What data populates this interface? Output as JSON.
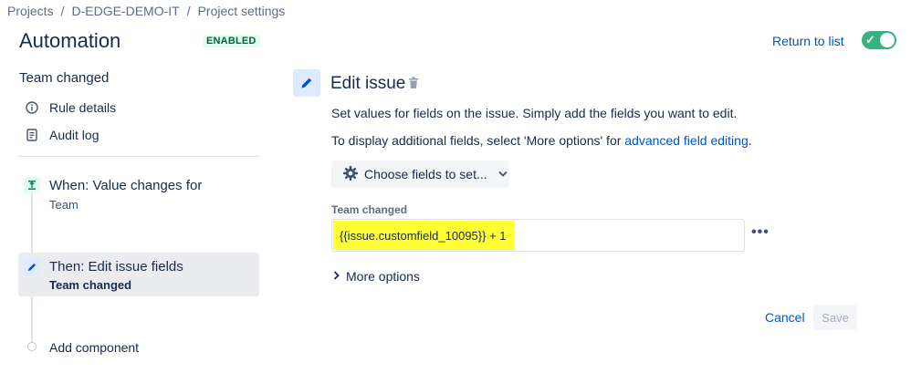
{
  "breadcrumb": [
    "Projects",
    "D-EDGE-DEMO-IT",
    "Project settings"
  ],
  "breadcrumb_separator": "/",
  "header": {
    "title": "Automation",
    "status_badge": "ENABLED",
    "return_link": "Return to list",
    "toggle_state": "on"
  },
  "sidebar": {
    "rule_name": "Team changed",
    "items": [
      {
        "label": "Rule details",
        "icon": "info-icon"
      },
      {
        "label": "Audit log",
        "icon": "document-icon"
      }
    ],
    "steps": [
      {
        "title": "When: Value changes for",
        "subtitle": "Team",
        "icon": "trigger-icon"
      },
      {
        "title": "Then: Edit issue fields",
        "subtitle": "Team changed",
        "icon": "pencil-icon",
        "selected": true
      }
    ],
    "add_component": "Add component"
  },
  "main": {
    "title": "Edit issue",
    "description": "Set values for fields on the issue. Simply add the fields you want to edit.",
    "additional_text": "To display additional fields, select 'More options' for ",
    "additional_link": "advanced field editing",
    "additional_suffix": ".",
    "choose_fields_label": "Choose fields to set...",
    "field": {
      "label": "Team changed",
      "value": "{{issue.customfield_10095}} + 1"
    },
    "more_options_label": "More options",
    "cancel_label": "Cancel",
    "save_label": "Save"
  },
  "colors": {
    "accent": "#0052cc",
    "toggle": "#36b37e",
    "highlight": "#ffff33",
    "badge_text": "#006644",
    "badge_bg": "#e3fcef"
  }
}
